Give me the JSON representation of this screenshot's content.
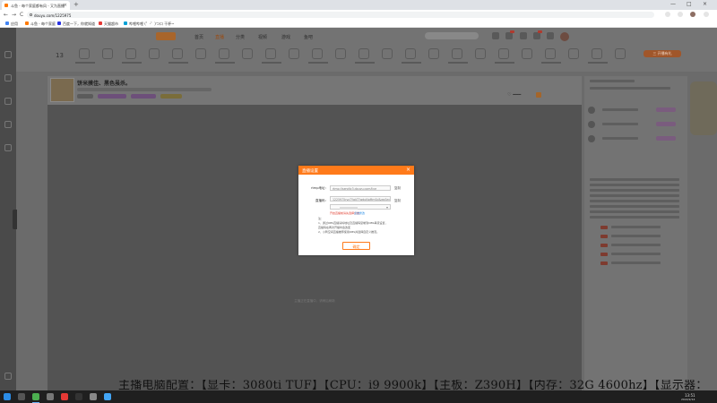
{
  "browser": {
    "tab_title": "斗鱼 - 每个家庭都有风 - 又为直播",
    "tab_close": "×",
    "new_tab": "+",
    "url": "douyu.com/1225975",
    "nav_back": "←",
    "nav_forward": "→",
    "nav_reload": "C",
    "win_min": "—",
    "win_max": "□",
    "win_close": "×",
    "bookmarks": [
      {
        "label": "应用",
        "color": "#4285f4"
      },
      {
        "label": "斗鱼 - 每个家庭",
        "color": "#ff7a00"
      },
      {
        "label": "百度一下，你就知道",
        "color": "#2932e1"
      },
      {
        "label": "天猫超市",
        "color": "#e53935"
      },
      {
        "label": "哔哩哔哩 (゜-゜)つロ 干杯~",
        "color": "#00a1d6"
      }
    ]
  },
  "site": {
    "nav_links": [
      "首页",
      "直播",
      "分类",
      "视频",
      "游戏",
      "鱼吧"
    ],
    "active_nav_index": 1,
    "category_count": "13",
    "open_live_label": "三 开播有礼"
  },
  "room": {
    "title": "饼米摸佳、黑色虽杀。"
  },
  "video": {
    "tip": "主播正在直播中，请稍后刷新"
  },
  "modal": {
    "title": "直播设置",
    "close": "×",
    "rtmp_label": "rtmp地址：",
    "rtmp_value": "rtmp://sendtc3.douyu.com/live",
    "copy1": "复制",
    "stream_label": "直播码：",
    "stream_value": "1225975rvz7YgkTFwdpNoMmSd&wsSecret=",
    "copy2": "复制",
    "hint_red": "开启直播前请先选择分类，",
    "hint_link": "点击修改",
    "notes_title": "注：",
    "notes": [
      "1、通过OBS直播请将地址及直播码复制到OBS串流设置，",
      "直播码在再次开播时会改变",
      "2、小鸭空间直播推荐使用OBS并选择自定义推流。"
    ],
    "confirm": "确定"
  },
  "subtitle": "主播电脑配置：【显卡：3080ti TUF】【CPU：i9 9900k】【主板：Z390H】【内存：32G 4600hz】【显示器：",
  "taskbar": {
    "time": "13:51",
    "date": "2022/2/14"
  }
}
